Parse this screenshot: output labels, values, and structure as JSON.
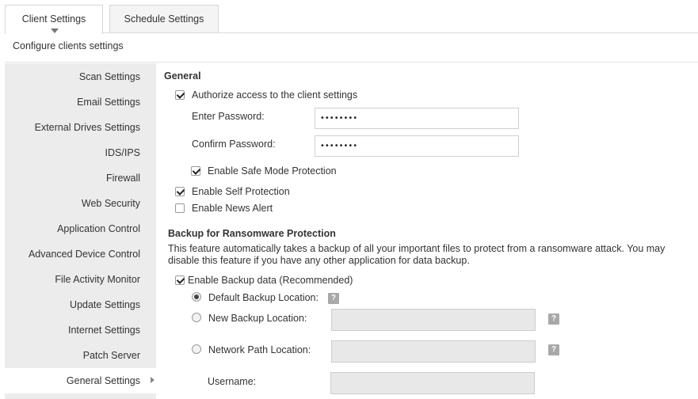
{
  "tabs": [
    {
      "label": "Client Settings",
      "active": true
    },
    {
      "label": "Schedule Settings",
      "active": false
    }
  ],
  "subtitle": "Configure clients settings",
  "sidebar": {
    "items": [
      {
        "label": "Scan Settings"
      },
      {
        "label": "Email Settings"
      },
      {
        "label": "External Drives Settings"
      },
      {
        "label": "IDS/IPS"
      },
      {
        "label": "Firewall"
      },
      {
        "label": "Web Security"
      },
      {
        "label": "Application Control"
      },
      {
        "label": "Advanced Device Control"
      },
      {
        "label": "File Activity Monitor"
      },
      {
        "label": "Update Settings"
      },
      {
        "label": "Internet Settings"
      },
      {
        "label": "Patch Server"
      },
      {
        "label": "General Settings",
        "active": true
      }
    ]
  },
  "general": {
    "heading": "General",
    "authorize_label": "Authorize access to the client settings",
    "authorize_checked": true,
    "enter_password_label": "Enter Password:",
    "enter_password_value": "••••••••",
    "confirm_password_label": "Confirm Password:",
    "confirm_password_value": "••••••••",
    "safe_mode_label": "Enable Safe Mode Protection",
    "safe_mode_checked": true,
    "self_protection_label": "Enable Self Protection",
    "self_protection_checked": true,
    "news_alert_label": "Enable News Alert",
    "news_alert_checked": false
  },
  "backup": {
    "heading": "Backup for Ransomware Protection",
    "description": "This feature automatically takes a backup of all your important files to protect from a ransomware attack. You may disable this feature if you have any other application for data backup.",
    "enable_label": "Enable Backup data (Recommended)",
    "enable_checked": true,
    "default_location_label": "Default Backup Location:",
    "new_location_label": "New Backup Location:",
    "network_path_label": "Network Path Location:",
    "username_label": "Username:",
    "help_glyph": "?"
  },
  "colors": {
    "sidebar_bg": "#ececec",
    "disabled_field_bg": "#e8e8e8",
    "help_icon_bg": "#a8a8a8"
  }
}
